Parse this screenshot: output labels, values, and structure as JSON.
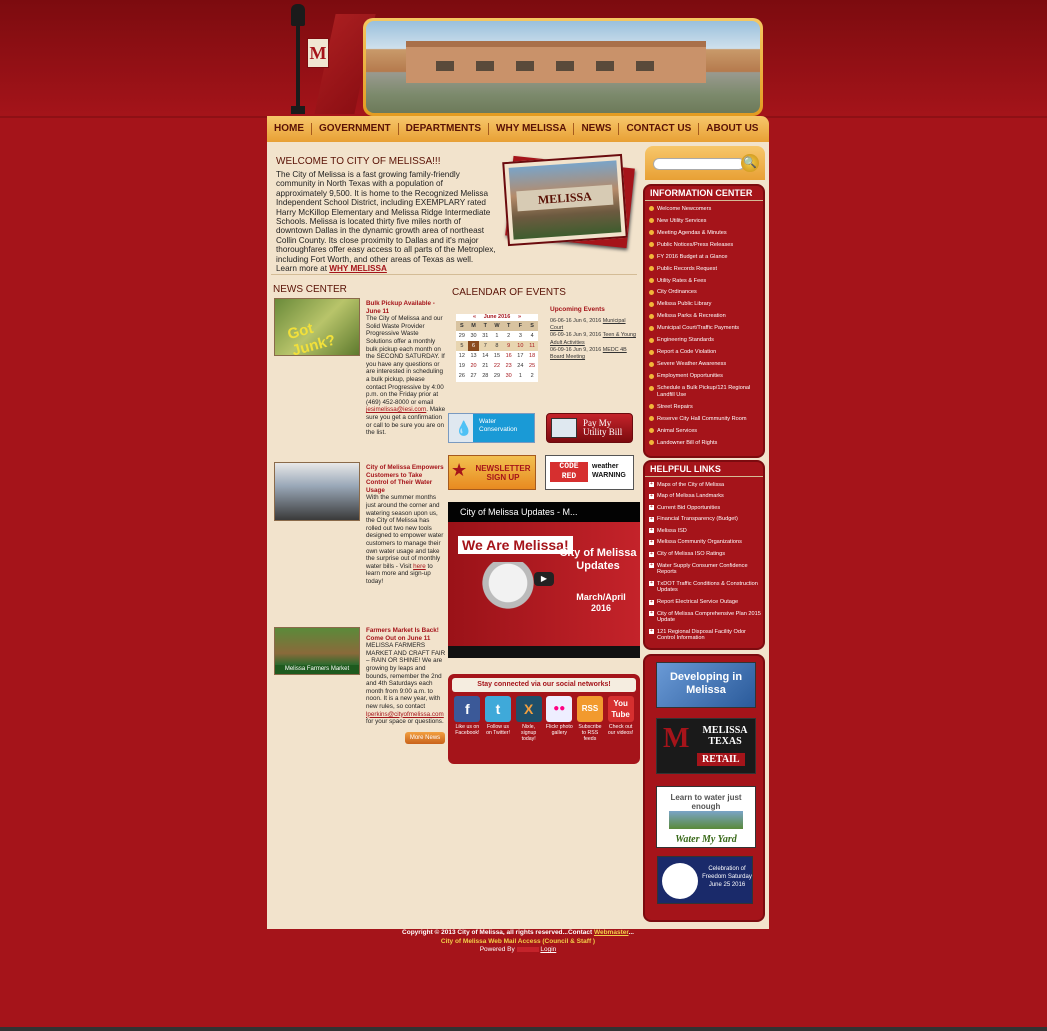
{
  "nav": [
    "HOME",
    "GOVERNMENT",
    "DEPARTMENTS",
    "WHY MELISSA",
    "NEWS",
    "CONTACT US",
    "ABOUT US"
  ],
  "logo": {
    "letter": "M",
    "text": "MELISSA TEXAS"
  },
  "welcome": {
    "title": "WELCOME TO CITY OF MELISSA!!!",
    "body": "The City of Melissa is a fast growing family-friendly community in North Texas with a population of approximately 9,500.  It is home to the Recognized Melissa Independent School District, including EXEMPLARY rated Harry McKillop Elementary and Melissa Ridge Intermediate Schools.   Melissa is located thirty five miles north of downtown Dallas in the dynamic growth area of northeast Collin County.  Its close proximity to Dallas and it's major thoroughfares offer easy access to all parts of the Metroplex, including Fort Worth, and other areas of Texas as well.  Learn more at ",
    "link": "WHY MELISSA",
    "sign_text": "MELISSA"
  },
  "news": {
    "title": "NEWS CENTER",
    "items": [
      {
        "headline": "Bulk Pickup Available - June 11",
        "body": "The City of Melissa and our Solid Waste Provider Progressive Waste Solutions offer a monthly bulk pickup each month on the SECOND SATURDAY. If you have any questions or are interested in scheduling a bulk pickup, please contact Progressive by 4:00 p.m. on the Friday prior at (469) 452-8000 or email ",
        "email": "jesimelissa@iesi.com",
        "tail": ". Make sure you get a confirmation or call to be sure you are on the list.",
        "thumb_label": "Got Junk?"
      },
      {
        "headline": "City of Melissa Empowers Customers to Take Control of Their Water Usage",
        "body": "With the summer months just around the corner and watering season upon us, the City of Melissa has rolled out two new tools designed to empower water customers to manage their own water usage and take the surprise out of monthly water bills - Visit ",
        "link": "here",
        "tail": " to learn more and sign-up today!"
      },
      {
        "headline": "Farmers Market Is Back! Come Out on June 11",
        "body": "MELISSA FARMERS MARKET AND CRAFT FAIR – RAIN OR SHINE! We are growing by leaps and bounds, remember the 2nd and 4th Saturdays each month from 9:00 a.m. to noon. It is a new year, with new rules, so contact ",
        "email": "lperkins@cityofmelissa.com",
        "tail": " for your space or questions.",
        "thumb_label": "Melissa Farmers Market"
      }
    ],
    "more": "More News"
  },
  "calendar": {
    "title": "CALENDAR OF EVENTS",
    "month": "June 2016",
    "prev": "«",
    "next": "»",
    "days": [
      "S",
      "M",
      "T",
      "W",
      "T",
      "F",
      "S"
    ],
    "weeks": [
      [
        "29",
        "30",
        "31",
        "1",
        "2",
        "3",
        "4"
      ],
      [
        "5",
        "6",
        "7",
        "8",
        "9",
        "10",
        "11"
      ],
      [
        "12",
        "13",
        "14",
        "15",
        "16",
        "17",
        "18"
      ],
      [
        "19",
        "20",
        "21",
        "22",
        "23",
        "24",
        "25"
      ],
      [
        "26",
        "27",
        "28",
        "29",
        "30",
        "1",
        "2"
      ]
    ],
    "upcoming_title": "Upcoming Events",
    "events": [
      {
        "date": "06-06-16 Jun 6, 2016",
        "name": "Municipal Court"
      },
      {
        "date": "06-09-16 Jun 9, 2016",
        "name": "Teen & Young Adult Activities"
      },
      {
        "date": "06-09-16 Jun 9, 2016",
        "name": "MEDC 4B Board Meeting"
      }
    ]
  },
  "promos": {
    "water": "Water Conservation",
    "pay": "Pay My Utility Bill",
    "newsletter": "NEWSLETTER SIGN UP",
    "code_red": "CODE RED",
    "weather": "weather WARNING"
  },
  "video": {
    "title": "City of Melissa Updates - M...",
    "banner": "We Are Melissa!",
    "heading": "City of Melissa Updates",
    "date": "March/April 2016"
  },
  "social": {
    "title": "Stay connected via our social networks!",
    "items": [
      {
        "icon": "f",
        "label": "Like us on Facebook!",
        "color": "#3b5998"
      },
      {
        "icon": "t",
        "label": "Follow us on Twitter!",
        "color": "#3fa9d9"
      },
      {
        "icon": "X",
        "label": "Nixle, signup today!",
        "color": "#1f4f6a"
      },
      {
        "icon": "●●",
        "label": "Flickr photo gallery",
        "color": "#eef"
      },
      {
        "icon": "RSS",
        "label": "Subscribe to RSS feeds",
        "color": "#f29a2e"
      },
      {
        "icon": "You Tube",
        "label": "Check out our videos!",
        "color": "#d62f2f"
      }
    ]
  },
  "search": {
    "placeholder": "",
    "go": "🔍"
  },
  "info_center": {
    "title": "INFORMATION CENTER",
    "items": [
      "Welcome Newcomers",
      "New Utility Services",
      "Meeting Agendas & Minutes",
      "Public Notices/Press Releases",
      "FY 2016 Budget at a Glance",
      "Public Records Request",
      "Utility Rates & Fees",
      "City Ordinances",
      "Melissa Public Library",
      "Melissa Parks & Recreation",
      "Municipal Court/Traffic Payments",
      "Engineering Standards",
      "Report a Code Violation",
      "Severe Weather Awareness",
      "Employment Opportunities",
      "Schedule a Bulk Pickup/121 Regional Landfill Use",
      "Street Repairs",
      "Reserve City Hall Community Room",
      "Animal Services",
      "Landowner Bill of Rights"
    ]
  },
  "helpful_links": {
    "title": "HELPFUL LINKS",
    "items": [
      "Maps of the City of Melissa",
      "Map of Melissa Landmarks",
      "Current Bid Opportunities",
      "Financial Transparency (Budget)",
      "Melissa ISD",
      "Melissa Community Organizations",
      "City of Melissa ISO Ratings",
      "Water Supply Consumer Confidence Reports",
      "TxDOT Traffic Conditions & Construction Updates",
      "Report Electrical Service Outage",
      "City of Melissa Comprehensive Plan 2015 Update",
      "121 Regional Disposal Facility Odor Control Information"
    ]
  },
  "side_ads": {
    "developing": "Developing in Melissa",
    "retail_top": "MELISSA TEXAS",
    "retail": "RETAIL",
    "water1": "Learn to water just enough",
    "water2": "Water My Yard",
    "freedom": "Celebration of Freedom Saturday June 25 2016"
  },
  "footer": {
    "copyright": "Copyright © 2013 City of Melissa, all rights reserved...Contact ",
    "webmaster": "Webmaster",
    "dots": "...",
    "webmail": "City of Melissa Web Mail Access (Council & Staff )",
    "powered": "Powered By",
    "login": "Login"
  },
  "colors": {
    "brand": "#a5141a",
    "accent": "#e8a035",
    "page": "#f2e3cc"
  }
}
